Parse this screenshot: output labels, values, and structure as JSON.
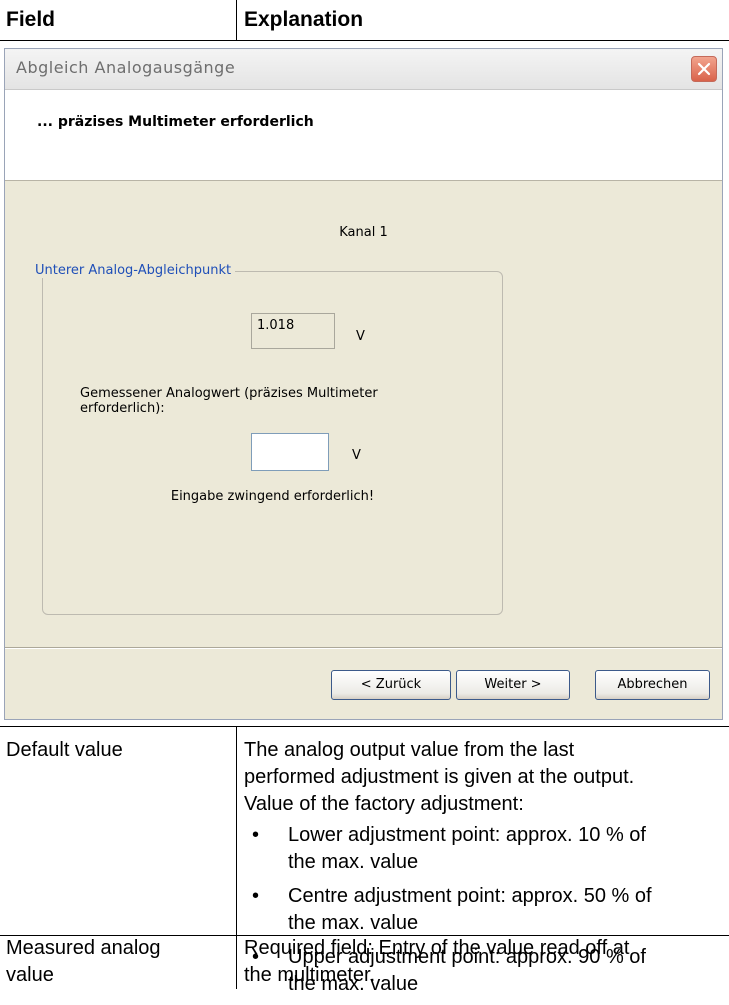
{
  "table": {
    "header": {
      "field": "Field",
      "explanation": "Explanation"
    },
    "rows": [
      {
        "field": "Default value",
        "explanation_lines": [
          "The analog output value from the last",
          "performed adjustment is given at the output.",
          "Value of the factory adjustment:"
        ],
        "bullets": [
          {
            "line1": "Lower adjustment point: approx. 10 % of",
            "line2": "the max. value"
          },
          {
            "line1": "Centre adjustment point: approx. 50 % of",
            "line2": "the max. value"
          },
          {
            "line1": "Upper adjustment point: approx. 90 % of",
            "line2": "the max. value"
          }
        ],
        "bullet_char": "•"
      },
      {
        "field_lines": [
          "Measured analog",
          "value"
        ],
        "explanation_lines": [
          "Required field: Entry of the value read off at",
          "the multimeter."
        ]
      }
    ]
  },
  "dialog": {
    "title": "Abgleich Analogausgänge",
    "banner": "... präzises Multimeter erforderlich",
    "channel": "Kanal 1",
    "group_title": "Unterer Analog-Abgleichpunkt",
    "default_value": "1.018",
    "unit": "V",
    "measured_label": "Gemessener Analogwert (präzises Multimeter erforderlich):",
    "measured_value": "",
    "required_note": "Eingabe zwingend erforderlich!",
    "buttons": {
      "back": "< Zurück",
      "next": "Weiter >",
      "cancel": "Abbrechen"
    },
    "icons": {
      "close": "close-icon"
    },
    "colors": {
      "group_title": "#1f4fb8",
      "close_button": "#d9624a",
      "dialog_bg": "#ece9d8"
    }
  }
}
